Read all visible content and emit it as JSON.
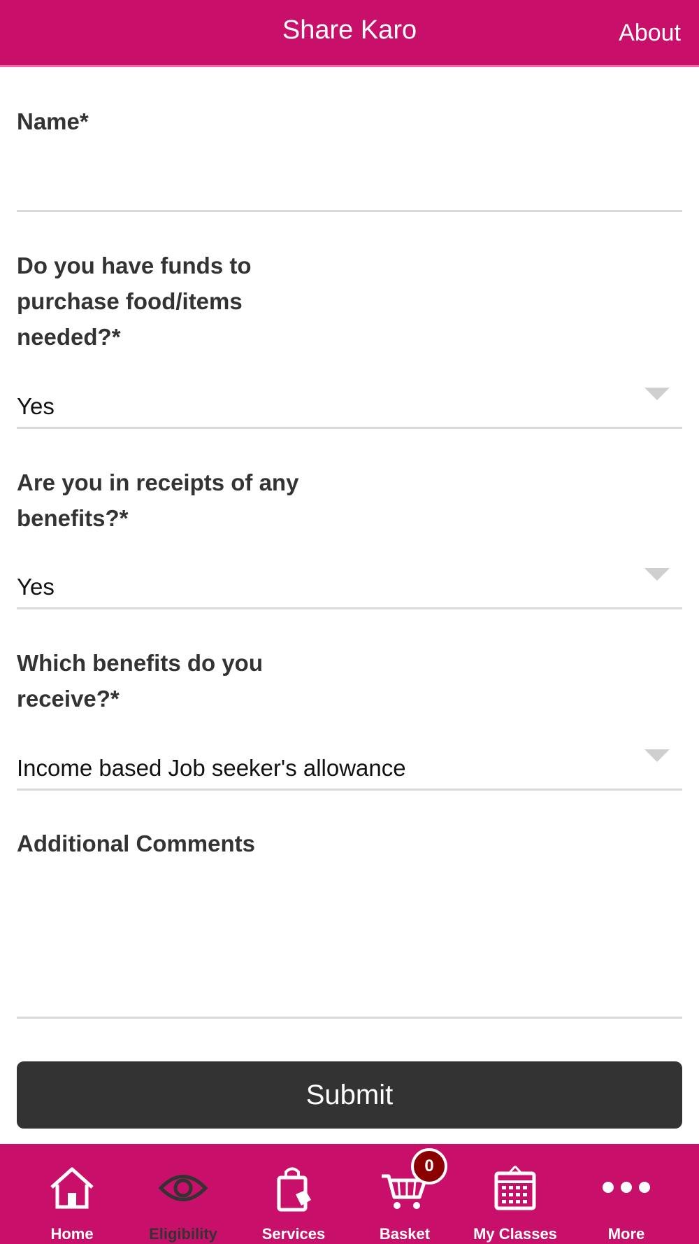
{
  "header": {
    "title": "Share Karo",
    "about_label": "About"
  },
  "form": {
    "name": {
      "label": "Name*",
      "value": ""
    },
    "funds": {
      "label": "Do you have funds to purchase food/items needed?*",
      "value": "Yes"
    },
    "benefits": {
      "label": "Are you in receipts of any benefits?*",
      "value": "Yes"
    },
    "which_benefits": {
      "label": "Which benefits do you receive?*",
      "value": "Income based Job seeker's allowance"
    },
    "comments": {
      "label": "Additional Comments",
      "value": ""
    },
    "submit_label": "Submit"
  },
  "tabbar": {
    "items": [
      {
        "label": "Home",
        "icon": "home-icon"
      },
      {
        "label": "Eligibility",
        "icon": "eye-icon",
        "active": true
      },
      {
        "label": "Services",
        "icon": "shopping-bag-icon"
      },
      {
        "label": "Basket",
        "icon": "cart-icon",
        "badge": "0"
      },
      {
        "label": "My Classes",
        "icon": "calendar-icon"
      },
      {
        "label": "More",
        "icon": "more-dots-icon"
      }
    ]
  },
  "colors": {
    "brand": "#c8106a",
    "button": "#333333",
    "badge": "#8b0000"
  }
}
